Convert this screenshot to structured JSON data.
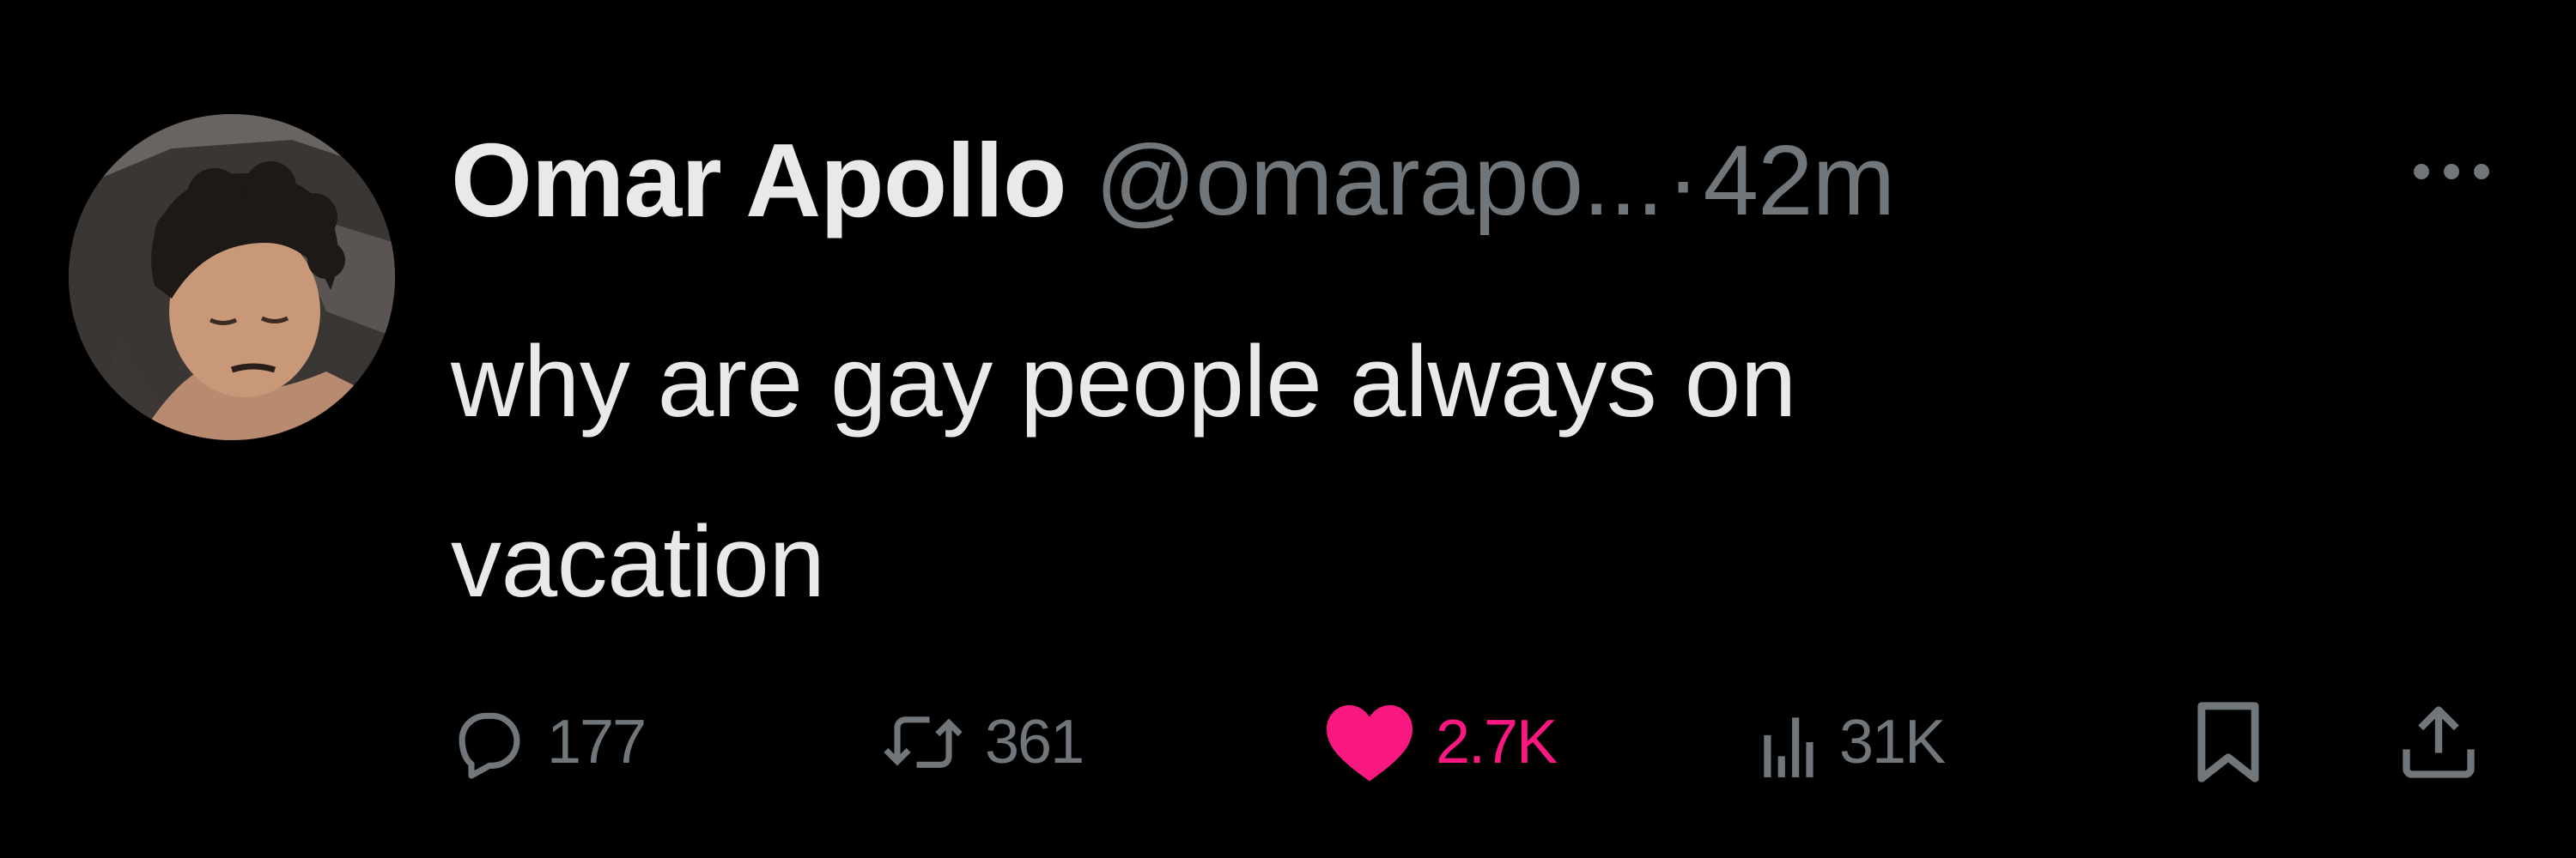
{
  "tweet": {
    "author": {
      "name": "Omar Apollo",
      "handle": "@omarapo...",
      "avatar_icon": "user-avatar"
    },
    "separator": "·",
    "time": "42m",
    "text_line1": "why are gay people always on",
    "text_line2": "vacation",
    "more_icon": "more-dots-icon",
    "actions": {
      "replies": {
        "icon": "reply-icon",
        "count": "177"
      },
      "reposts": {
        "icon": "repost-icon",
        "count": "361"
      },
      "likes": {
        "icon": "heart-icon",
        "count": "2.7K",
        "liked": true
      },
      "views": {
        "icon": "views-chart-icon",
        "count": "31K"
      },
      "bookmark": {
        "icon": "bookmark-icon"
      },
      "share": {
        "icon": "share-icon"
      }
    },
    "colors": {
      "background": "#000000",
      "primary_text": "#e7e9ea",
      "secondary_text": "#71767b",
      "like_pink": "#f91880"
    }
  }
}
